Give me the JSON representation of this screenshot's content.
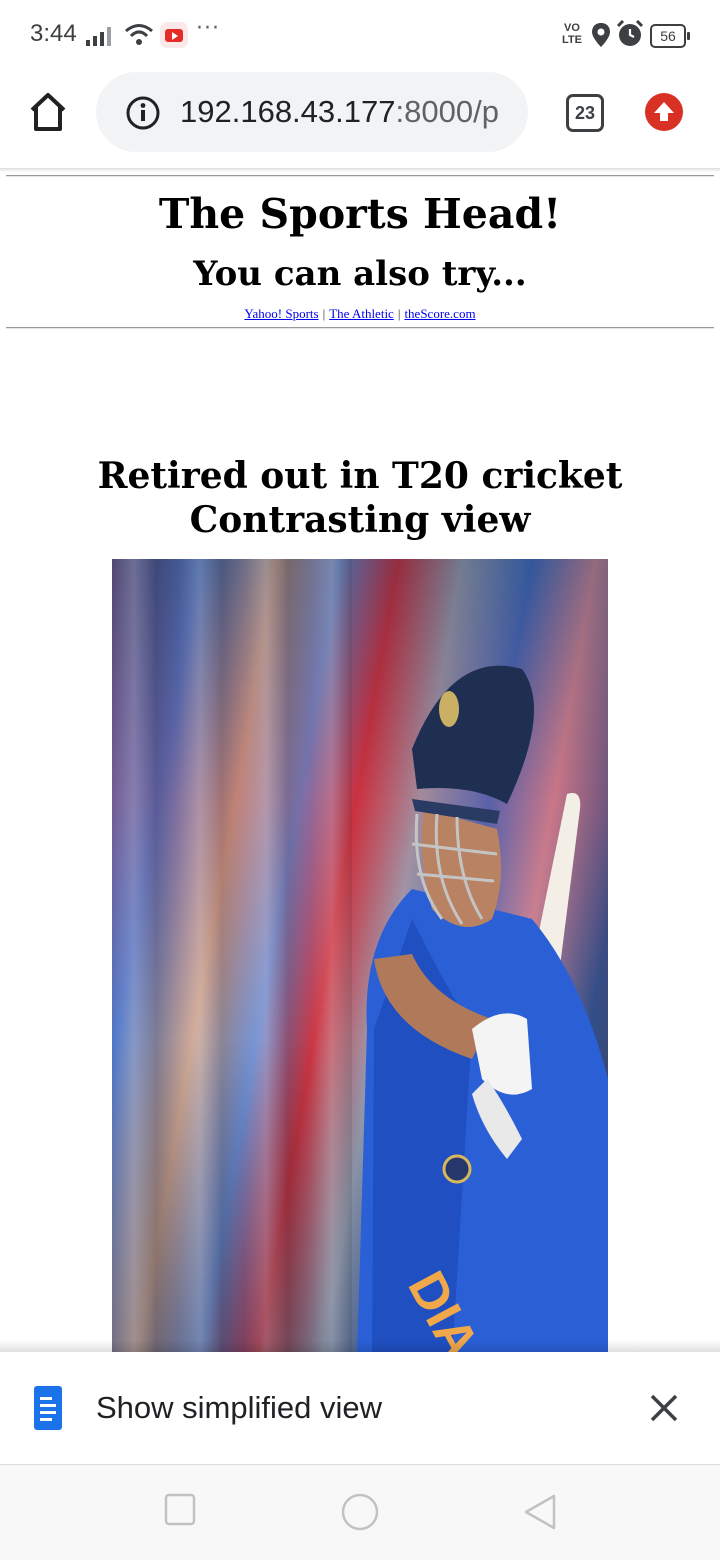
{
  "status_bar": {
    "time": "3:44",
    "network_label": "VO\nLTE",
    "network_label_top": "VO",
    "network_label_bottom": "LTE",
    "battery": "56",
    "overflow": "···"
  },
  "browser": {
    "url_main": "192.168.43.177",
    "url_rest": ":8000/p",
    "tab_count": "23"
  },
  "page": {
    "title": "The Sports Head!",
    "subtitle": "You can also try...",
    "links": [
      "Yahoo! Sports",
      "The Athletic",
      "theScore.com"
    ],
    "link_separator": "|",
    "article_title_line1": "Retired out in T20 cricket",
    "article_title_line2": "Contrasting view",
    "image_text": "DIA"
  },
  "prompt": {
    "label": "Show simplified view"
  },
  "colors": {
    "update_badge": "#d93025",
    "link": "#0000ee",
    "url_bar": "#f1f3f4",
    "doc_icon": "#1a73e8"
  }
}
